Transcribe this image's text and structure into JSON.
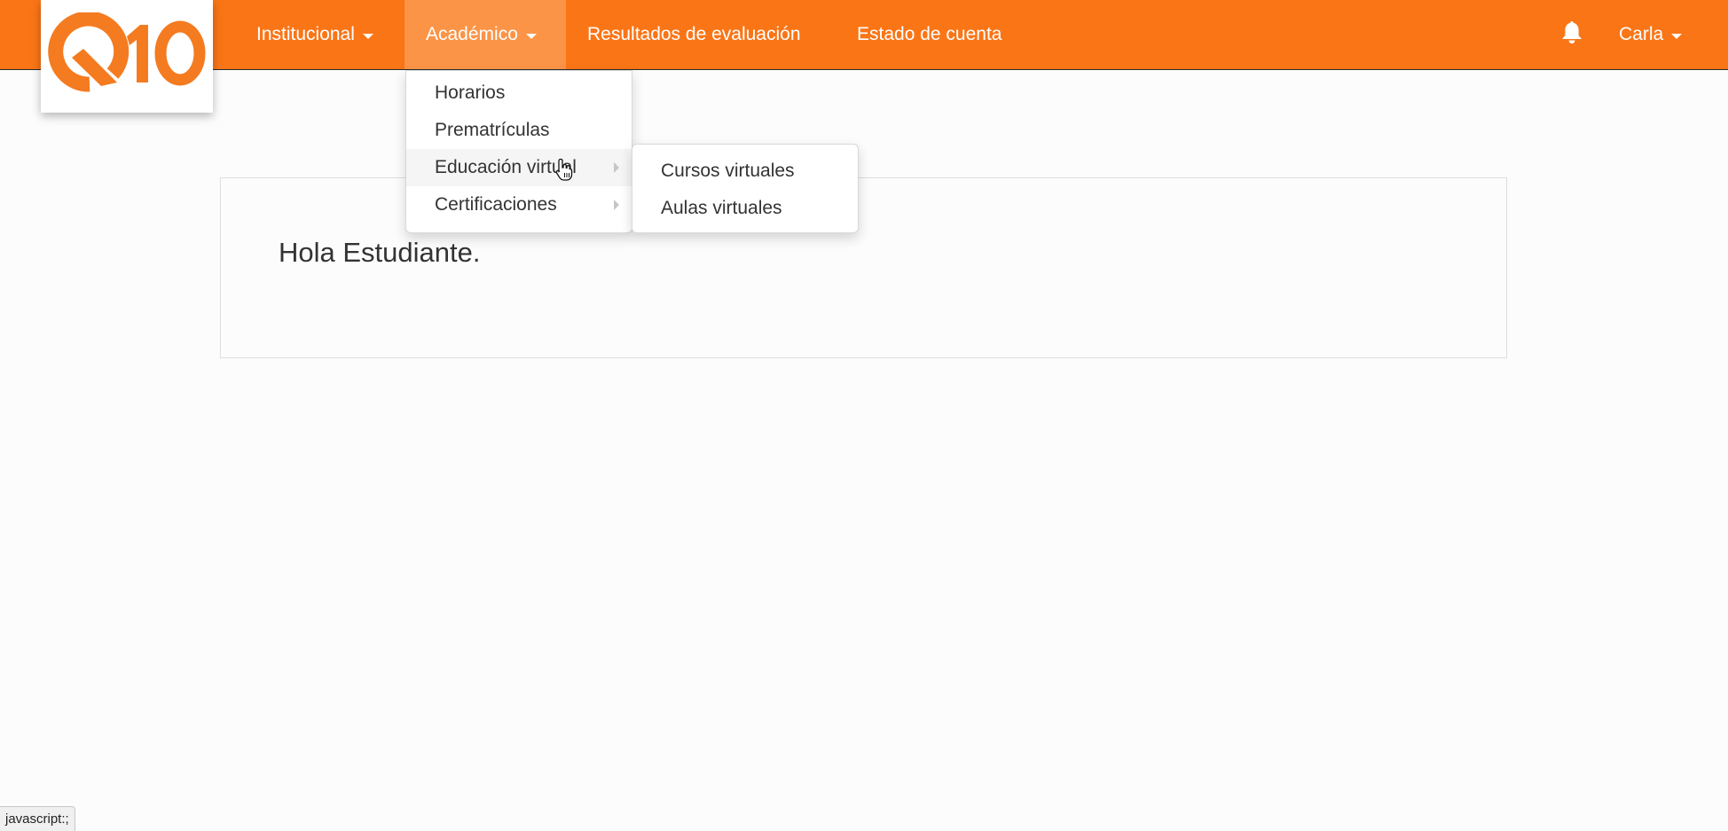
{
  "brand": {
    "logo_text": "Q10",
    "accent_color": "#fa7516"
  },
  "navbar": {
    "items": [
      {
        "label": "Institucional",
        "has_caret": true
      },
      {
        "label": "Académico",
        "has_caret": true,
        "open": true
      },
      {
        "label": "Resultados de evaluación"
      },
      {
        "label": "Estado de cuenta"
      }
    ],
    "notifications_icon": "bell-icon",
    "user": {
      "label": "Carla",
      "has_caret": true
    }
  },
  "dropdown": {
    "items": [
      {
        "label": "Horarios"
      },
      {
        "label": "Prematrículas"
      },
      {
        "label": "Educación virtual",
        "has_submenu": true,
        "hovered": true
      },
      {
        "label": "Certificaciones",
        "has_submenu": true
      }
    ]
  },
  "submenu": {
    "items": [
      {
        "label": "Cursos virtuales"
      },
      {
        "label": "Aulas virtuales"
      }
    ]
  },
  "main": {
    "greeting": "Hola Estudiante."
  },
  "status_bar": {
    "text": "javascript:;"
  }
}
